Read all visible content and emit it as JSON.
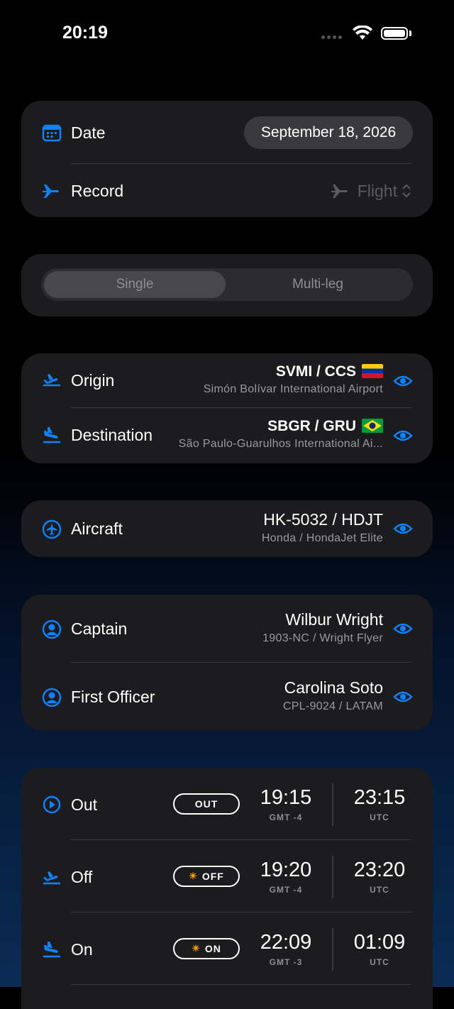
{
  "status": {
    "time": "20:19"
  },
  "date_card": {
    "date_label": "Date",
    "date_value": "September 18, 2026",
    "record_label": "Record",
    "record_value": "Flight"
  },
  "segment": {
    "single": "Single",
    "multi": "Multi-leg",
    "selected": "Single"
  },
  "route": {
    "origin_label": "Origin",
    "origin_code": "SVMI / CCS",
    "origin_name": "Simón Bolívar International Airport",
    "origin_flag": "venezuela-flag",
    "destination_label": "Destination",
    "destination_code": "SBGR / GRU",
    "destination_name": "São Paulo-Guarulhos International Ai...",
    "destination_flag": "brazil-flag"
  },
  "aircraft": {
    "label": "Aircraft",
    "registration": "HK-5032 / HDJT",
    "model": "Honda / HondaJet Elite"
  },
  "crew": {
    "captain_label": "Captain",
    "captain_name": "Wilbur Wright",
    "captain_sub": "1903-NC / Wright Flyer",
    "fo_label": "First Officer",
    "fo_name": "Carolina Soto",
    "fo_sub": "CPL-9024 / LATAM"
  },
  "times": [
    {
      "label": "Out",
      "pill": "OUT",
      "local": "19:15",
      "local_zone": "GMT -4",
      "utc": "23:15",
      "utc_zone": "UTC"
    },
    {
      "label": "Off",
      "pill": "OFF",
      "local": "19:20",
      "local_zone": "GMT -4",
      "utc": "23:20",
      "utc_zone": "UTC"
    },
    {
      "label": "On",
      "pill": "ON",
      "local": "22:09",
      "local_zone": "GMT -3",
      "utc": "01:09",
      "utc_zone": "UTC"
    }
  ],
  "colors": {
    "accent": "#0a84ff",
    "card": "#1c1c1e",
    "sun": "#ff9f0a"
  }
}
